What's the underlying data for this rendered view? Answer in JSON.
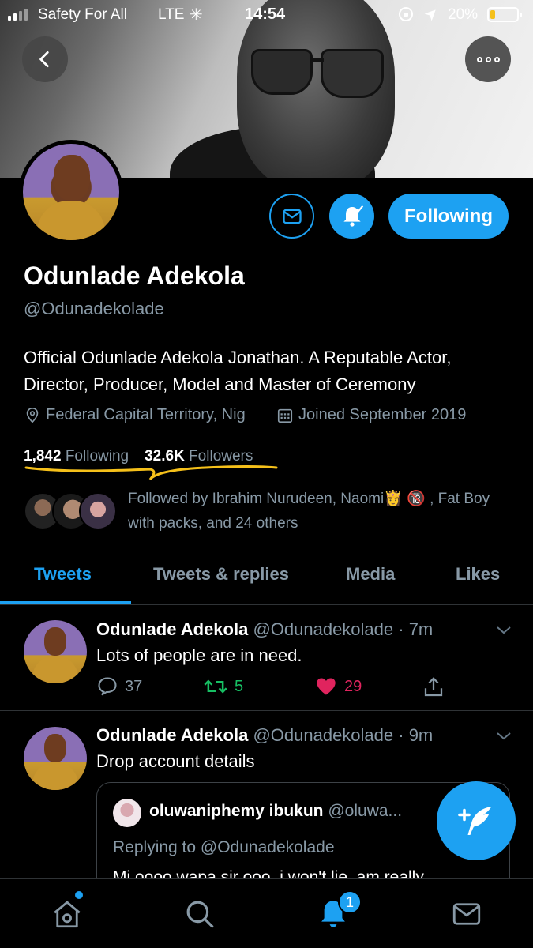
{
  "status_bar": {
    "carrier": "Safety For All",
    "network": "LTE",
    "time": "14:54",
    "battery_percent": "20%",
    "battery_level": 0.2
  },
  "profile": {
    "name": "Odunlade Adekola",
    "handle": "@Odunadekolade",
    "bio": "Official Odunlade Adekola Jonathan. A Reputable Actor, Director, Producer, Model and Master of Ceremony",
    "location": "Federal Capital Territory, Nig",
    "joined": "Joined September 2019",
    "following_count": "1,842",
    "following_label": "Following",
    "followers_count": "32.6K",
    "followers_label": "Followers",
    "followed_by": "Followed by Ibrahim Nurudeen, Naomi👸 🔞 , Fat Boy with packs, and 24 others",
    "follow_button_label": "Following"
  },
  "tabs": [
    {
      "label": "Tweets",
      "active": true
    },
    {
      "label": "Tweets & replies",
      "active": false
    },
    {
      "label": "Media",
      "active": false
    },
    {
      "label": "Likes",
      "active": false
    }
  ],
  "tweets": [
    {
      "author": "Odunlade Adekola",
      "meta": "@Odunadekolade · 7m",
      "text": "Lots of people are in need.",
      "replies": "37",
      "retweets": "5",
      "likes": "29"
    },
    {
      "author": "Odunlade Adekola",
      "meta": "@Odunadekolade · 9m",
      "text": "Drop account details",
      "quote": {
        "author": "oluwaniphemy ibukun",
        "handle": "@oluwa...",
        "replying_to": "Replying to @Odunadekolade",
        "text": "Mi oooo wapa sir ooo, i won't lie, am really"
      }
    }
  ],
  "bottom_nav": {
    "notification_badge": "1"
  },
  "colors": {
    "accent": "#1da1f2",
    "muted": "#8899a6",
    "retweet": "#17bf63",
    "like": "#e0245e",
    "highlight": "#f5c01a"
  }
}
